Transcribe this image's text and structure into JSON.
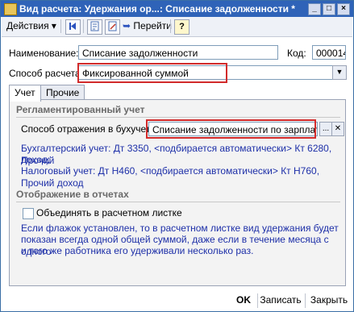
{
  "window": {
    "title": "Вид расчета: Удержания ор...: Списание задолженности *",
    "min_label": "_",
    "max_label": "□",
    "close_label": "×"
  },
  "toolbar": {
    "actions_label": "Действия",
    "navigate_label": "Перейти",
    "help_label": "?",
    "actions_arrow": "▾",
    "navigate_arrow": "▾"
  },
  "form": {
    "name_label": "Наименование:",
    "name_value": "Списание задолженности",
    "code_label": "Код:",
    "code_value": "000014",
    "method_label": "Способ расчета:",
    "method_value": "Фиксированной суммой"
  },
  "tabs": [
    {
      "label": "Учет",
      "active": true
    },
    {
      "label": "Прочие",
      "active": false
    }
  ],
  "accounting": {
    "section_title": "Регламентированный учет",
    "reflection_label": "Способ отражения в бухучете:",
    "reflection_value": "Списание задолженности по зарплате",
    "select_button": "...",
    "clear_button": "✕",
    "bu_line1": "Бухгалтерский учет: Дт 3350, <подбирается автоматически> Кт 6280, Прочий",
    "bu_line2": "доход;",
    "nu_line": "Налоговый учет: Дт Н460, <подбирается автоматически> Кт Н760, Прочий доход"
  },
  "reports": {
    "section_title": "Отображение в отчетах",
    "checkbox_label": "Объединять в расчетном листке",
    "help_line1": "Если флажок установлен, то в расчетном листке вид удержания будет",
    "help_line2": "показан всегда одной общей суммой, даже если в течение месяца с одного",
    "help_line3": "и того же работника его удерживали несколько раз."
  },
  "footer": {
    "ok_label": "OK",
    "save_label": "Записать",
    "close_label": "Закрыть"
  },
  "colors": {
    "title_bar": "#2f63b8",
    "highlight": "#d22b2b",
    "link_text": "#1d2fa8"
  }
}
